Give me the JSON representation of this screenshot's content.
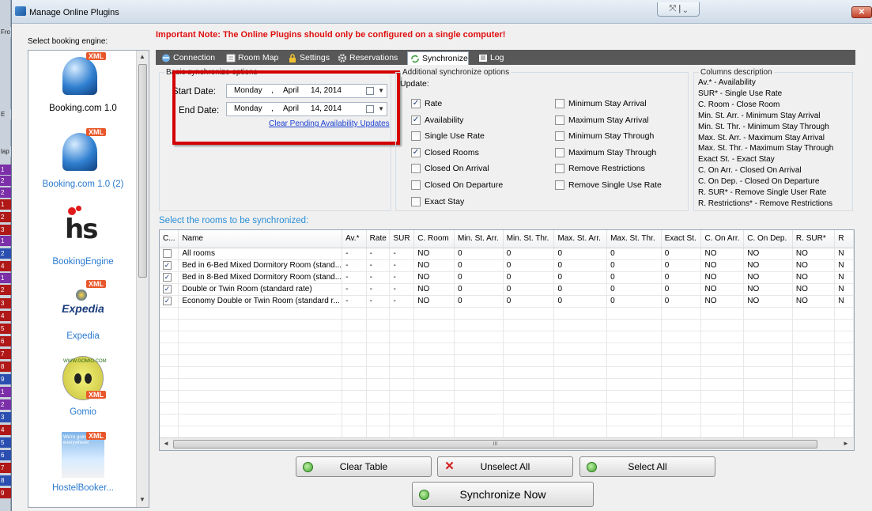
{
  "window": {
    "title": "Manage Online Plugins"
  },
  "background_strip": [
    "Fro",
    "E",
    "lap",
    "1",
    "2",
    "2",
    "1",
    "2",
    "3",
    "1",
    "2",
    "4",
    "1",
    "2",
    "3",
    "4",
    "5",
    "6",
    "7",
    "8",
    "9",
    "1",
    "2",
    "3",
    "4",
    "5",
    "6",
    "7",
    "8",
    "9"
  ],
  "engine_select_label": "Select booking engine:",
  "important_note": "Important Note:  The Online Plugins should only be configured on a single computer!",
  "engines": [
    {
      "label": "Booking.com 1.0",
      "badge": "XML"
    },
    {
      "label": "Booking.com 1.0 (2)",
      "badge": "XML"
    },
    {
      "label": "BookingEngine",
      "badge": ""
    },
    {
      "label": "Expedia",
      "badge": "XML"
    },
    {
      "label": "Gomio",
      "badge": "XML"
    },
    {
      "label": "HostelBooker...",
      "badge": "XML"
    }
  ],
  "logo_text": {
    "bookingengine": "hs",
    "expedia": "Expedia",
    "gomio": "WWW.GOMIO.COM",
    "hostelbooker": "We're going everywhere!"
  },
  "tabs": [
    "Connection",
    "Room Map",
    "Settings",
    "Reservations",
    "Synchronize",
    "Log"
  ],
  "basic": {
    "legend": "Basic synchronize options",
    "start_label": "Start Date:",
    "end_label": "End Date:",
    "start": {
      "day": "Monday",
      "sep": ",",
      "month": "April",
      "date": "14, 2014"
    },
    "end": {
      "day": "Monday",
      "sep": ",",
      "month": "April",
      "date": "14, 2014"
    },
    "clear_link": "Clear Pending Availability Updates"
  },
  "additional": {
    "legend": "Additional synchronize options",
    "update_label": "Update:",
    "left": [
      {
        "label": "Rate",
        "checked": true
      },
      {
        "label": "Availability",
        "checked": true
      },
      {
        "label": "Single Use Rate",
        "checked": false
      },
      {
        "label": "Closed Rooms",
        "checked": true
      },
      {
        "label": "Closed On Arrival",
        "checked": false
      },
      {
        "label": "Closed On Departure",
        "checked": false
      },
      {
        "label": "Exact Stay",
        "checked": false
      }
    ],
    "right": [
      {
        "label": "Minimum Stay Arrival",
        "checked": false
      },
      {
        "label": "Maximum Stay Arrival",
        "checked": false
      },
      {
        "label": "Minimum Stay Through",
        "checked": false
      },
      {
        "label": "Maximum Stay Through",
        "checked": false
      },
      {
        "label": "Remove Restrictions",
        "checked": false
      },
      {
        "label": "Remove Single Use Rate",
        "checked": false
      }
    ]
  },
  "columns_desc": {
    "legend": "Columns description",
    "lines": [
      "Av.* - Availability",
      "SUR* - Single Use Rate",
      "C. Room - Close Room",
      "Min. St. Arr. - Minimum Stay Arrival",
      "Min. St. Thr. - Minimum Stay Through",
      "Max. St. Arr. - Maximum Stay Arrival",
      "Max. St. Thr. - Maximum Stay Through",
      "Exact St. - Exact Stay",
      "C. On Arr. - Closed On Arrival",
      "C. On Dep. - Closed On Departure",
      "R. SUR* - Remove Single User Rate",
      "R. Restrictions* - Remove Restrictions"
    ]
  },
  "rooms_label": "Select the rooms to be synchronized:",
  "grid": {
    "headers": [
      "C...",
      "Name",
      "Av.*",
      "Rate",
      "SUR",
      "C. Room",
      "Min. St. Arr.",
      "Min. St. Thr.",
      "Max. St. Arr.",
      "Max. St. Thr.",
      "Exact St.",
      "C. On Arr.",
      "C. On Dep.",
      "R. SUR*",
      "R"
    ],
    "rows": [
      {
        "checked": false,
        "cells": [
          "All rooms",
          "-",
          "-",
          "-",
          "NO",
          "0",
          "0",
          "0",
          "0",
          "0",
          "NO",
          "NO",
          "NO",
          "N"
        ]
      },
      {
        "checked": true,
        "cells": [
          "Bed in 6-Bed Mixed Dormitory Room (stand...",
          "-",
          "-",
          "-",
          "NO",
          "0",
          "0",
          "0",
          "0",
          "0",
          "NO",
          "NO",
          "NO",
          "N"
        ]
      },
      {
        "checked": true,
        "cells": [
          "Bed in 8-Bed Mixed Dormitory Room (stand...",
          "-",
          "-",
          "-",
          "NO",
          "0",
          "0",
          "0",
          "0",
          "0",
          "NO",
          "NO",
          "NO",
          "N"
        ]
      },
      {
        "checked": true,
        "cells": [
          "Double or Twin Room (standard rate)",
          "-",
          "-",
          "-",
          "NO",
          "0",
          "0",
          "0",
          "0",
          "0",
          "NO",
          "NO",
          "NO",
          "N"
        ]
      },
      {
        "checked": true,
        "cells": [
          "Economy Double or Twin Room (standard r...",
          "-",
          "-",
          "-",
          "NO",
          "0",
          "0",
          "0",
          "0",
          "0",
          "NO",
          "NO",
          "NO",
          "N"
        ]
      }
    ]
  },
  "buttons": {
    "clear_table": "Clear Table",
    "unselect_all": "Unselect All",
    "select_all": "Select All",
    "synchronize_now": "Synchronize Now"
  },
  "glyphs": {
    "check": "✓",
    "scroll_grip": "III",
    "minmax": "⤧ | ⌄",
    "close": "✕"
  },
  "colors": {
    "important": "#e01010",
    "link": "#1a3fd0",
    "highlight": "#d40000",
    "tabbar": "#585858"
  }
}
